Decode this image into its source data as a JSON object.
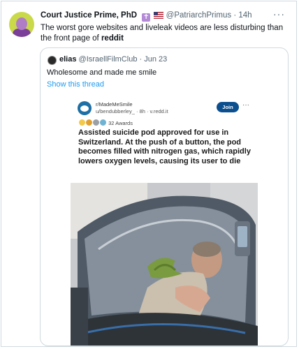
{
  "tweet": {
    "name": "Court Justice Prime, PhD",
    "handle": "@PatriarchPrimus",
    "time": "· 14h",
    "text_before": "The worst gore websites and liveleak videos are less disturbing than the front page of ",
    "text_bold": "reddit",
    "more_label": "···"
  },
  "quote": {
    "name": "elias",
    "handle": "@IsraellFilmClub",
    "time": "· Jun 23",
    "text": "Wholesome and made me smile",
    "show_thread": "Show this thread"
  },
  "reddit": {
    "subreddit": "r/MadeMeSmile",
    "user_line": "u/bendubberley_ · 8h · v.redd.it",
    "join_label": "Join",
    "more_label": "···",
    "awards_label": "32 Awards",
    "title": "Assisted suicide pod approved for use in Switzerland. At the push of a button, the pod becomes filled with nitrogen gas, which rapidly lowers oxygen levels, causing its user to die"
  }
}
